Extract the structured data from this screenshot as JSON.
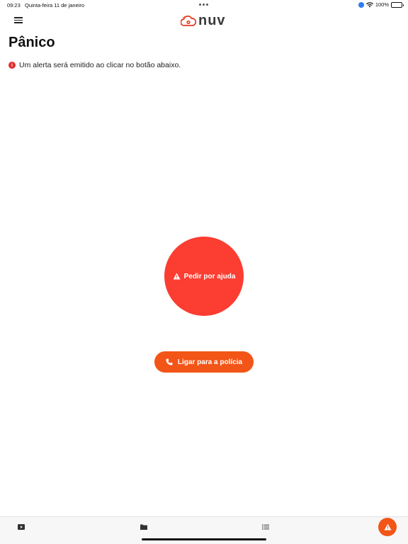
{
  "status_bar": {
    "time": "09:23",
    "date": "Quinta-feira 11 de janeiro",
    "battery": "100%"
  },
  "header": {
    "logo_text": "nuv",
    "menu_icon": "hamburger-menu-icon"
  },
  "page": {
    "title": "Pânico",
    "info_text": "Um alerta será emitido ao clicar no botão abaixo.",
    "info_icon_glyph": "i"
  },
  "panic_button": {
    "label": "Pedir por ajuda",
    "icon": "warning-triangle-icon"
  },
  "call_button": {
    "label": "Ligar para a polícia",
    "icon": "phone-icon"
  },
  "tab_bar": {
    "items": [
      {
        "icon": "video-play-icon"
      },
      {
        "icon": "folder-icon"
      },
      {
        "icon": "list-icon"
      },
      {
        "icon": "alert-icon"
      }
    ]
  },
  "colors": {
    "panic_red": "#fc3d31",
    "accent_orange": "#f25517",
    "info_red": "#e02d2d"
  }
}
